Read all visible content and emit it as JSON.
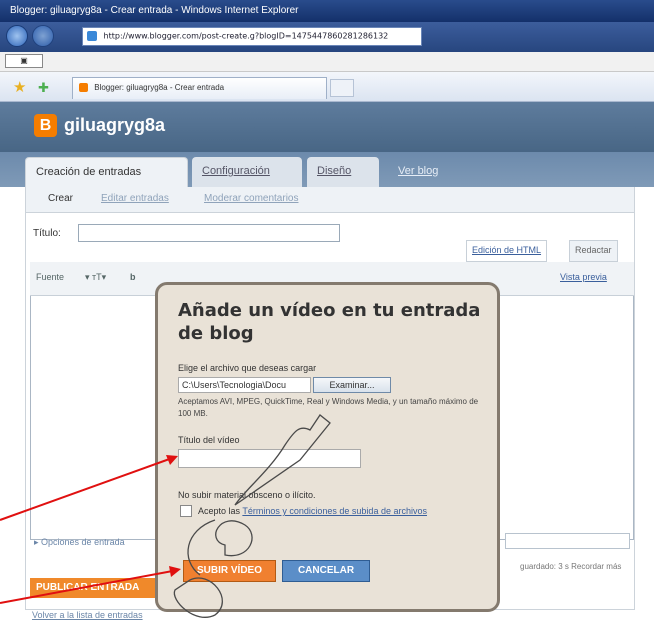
{
  "browser": {
    "window_title": "Blogger: giluagryg8a - Crear entrada - Windows Internet Explorer",
    "url": "http://www.blogger.com/post-create.g?blogID=1475447860281286132",
    "tab_title": "Blogger: giluagryg8a - Crear entrada"
  },
  "blog": {
    "name": "giluagryg8a"
  },
  "main_tabs": [
    {
      "label": "Creación de entradas"
    },
    {
      "label": "Configuración"
    },
    {
      "label": "Diseño"
    },
    {
      "label": "Ver blog"
    }
  ],
  "sub_tabs": [
    {
      "label": "Crear"
    },
    {
      "label": "Editar entradas"
    },
    {
      "label": "Moderar comentarios"
    }
  ],
  "editor": {
    "title_label": "Título:",
    "html_tab": "Edición de HTML",
    "compose_tab": "Redactar",
    "font_label": "Fuente",
    "preview_link": "Vista previa",
    "options_link": "Opciones de entrada",
    "publish_button": "PUBLICAR ENTRADA",
    "back_link": "Volver a la lista de entradas",
    "right_note": "guardado: 3 s  Recordar más"
  },
  "modal": {
    "title": "Añade un vídeo en tu entrada de blog",
    "file_label": "Elige el archivo que deseas cargar",
    "file_value": "C:\\Users\\Tecnologia\\Docu",
    "browse_button": "Examinar...",
    "help_text": "Aceptamos AVI, MPEG, QuickTime, Real y Windows Media, y un tamaño máximo de 100 MB.",
    "video_title_label": "Título del vídeo",
    "restriction_text": "No subir material obsceno o ilícito.",
    "accept_text": "Acepto las",
    "terms_link": "Términos y condiciones de subida de archivos",
    "upload_button": "SUBIR VÍDEO",
    "cancel_button": "CANCELAR"
  },
  "colors": {
    "brand_orange": "#f57d00",
    "upload_orange": "#f08030",
    "cancel_blue": "#5b8ec8",
    "arrow_red": "#e01010",
    "watermark_gray": "#4a4a4a"
  }
}
